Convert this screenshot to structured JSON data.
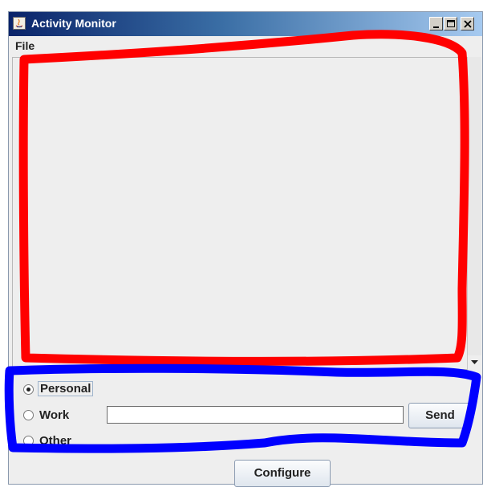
{
  "window": {
    "title": "Activity Monitor"
  },
  "menubar": {
    "items": [
      "File"
    ]
  },
  "textarea": {
    "content": ""
  },
  "message": {
    "categories": [
      {
        "label": "Personal",
        "selected": true
      },
      {
        "label": "Work",
        "selected": false
      },
      {
        "label": "Other",
        "selected": false
      }
    ],
    "input_value": "",
    "send_label": "Send"
  },
  "footer": {
    "configure_label": "Configure"
  },
  "annotation_colors": {
    "red": "#ff0000",
    "blue": "#0000ff"
  }
}
